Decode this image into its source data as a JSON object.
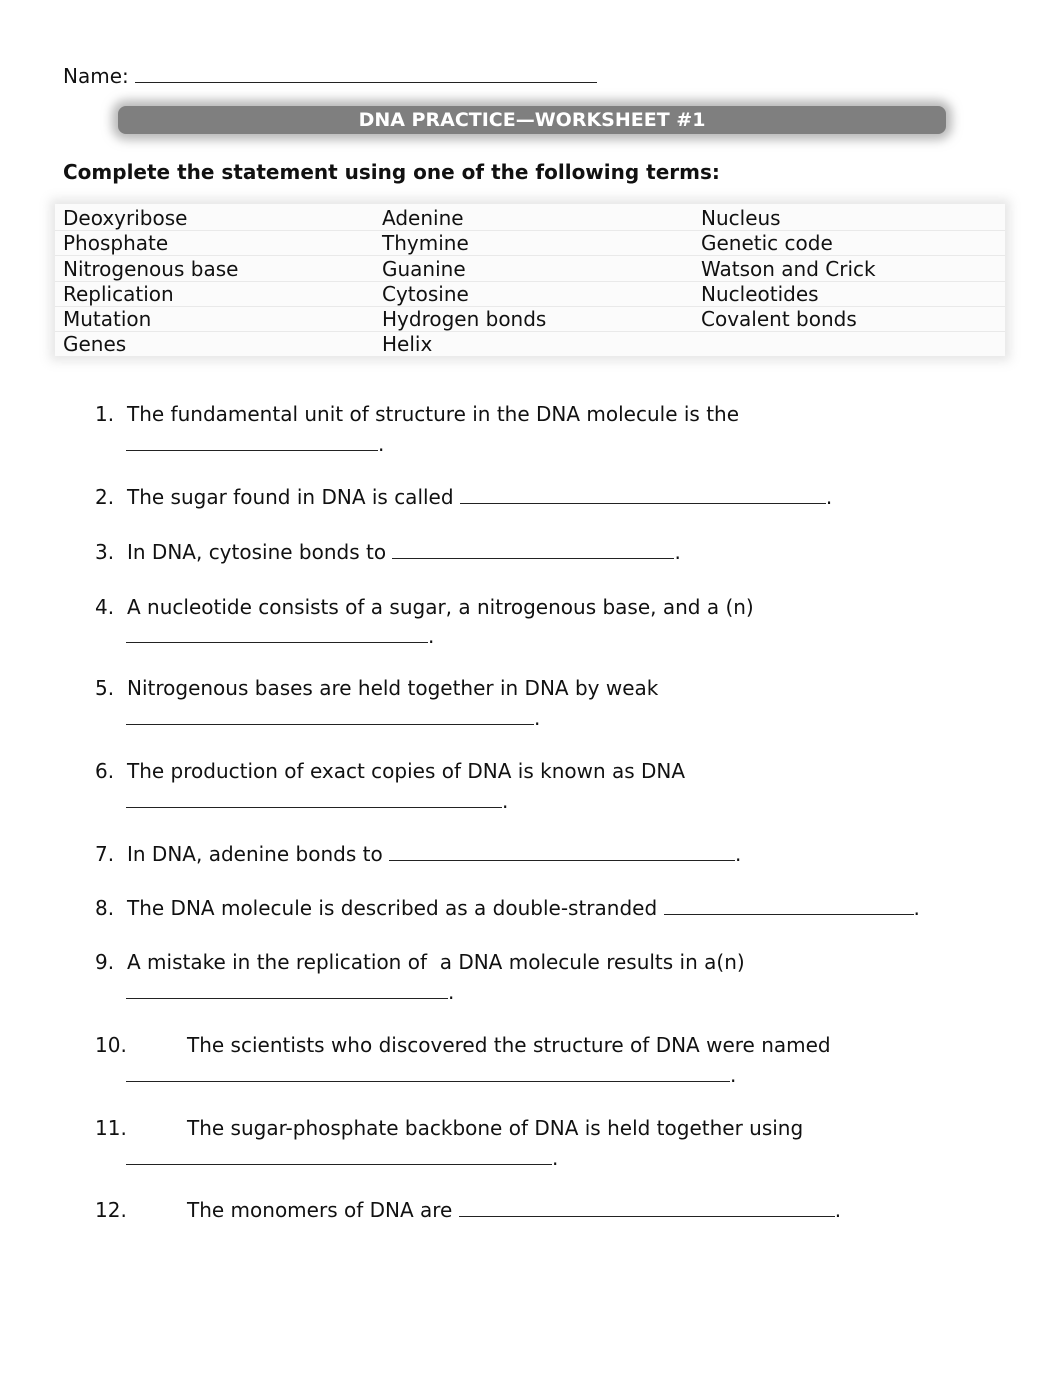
{
  "header": {
    "name_label": "Name:",
    "title": "DNA PRACTICE—WORKSHEET #1",
    "instructions": "Complete the statement using one of the following terms:"
  },
  "terms": {
    "column1": [
      "Deoxyribose",
      "Phosphate",
      "Nitrogenous base",
      "Replication",
      "Mutation",
      "Genes"
    ],
    "column2": [
      "Adenine",
      "Thymine",
      "Guanine",
      "Cytosine",
      "Hydrogen bonds",
      "Helix"
    ],
    "column3": [
      "Nucleus",
      "Genetic code",
      "Watson and Crick",
      "Nucleotides",
      "Covalent bonds",
      ""
    ]
  },
  "questions": [
    {
      "number": "1.",
      "text": "The fundamental unit of structure in the DNA molecule is the",
      "end": "."
    },
    {
      "number": "2.",
      "text": "The sugar found in DNA is called",
      "end": "."
    },
    {
      "number": "3.",
      "text": "In DNA, cytosine bonds to",
      "end": "."
    },
    {
      "number": "4.",
      "text": "A nucleotide consists of a sugar, a nitrogenous base, and a (n)",
      "end": "."
    },
    {
      "number": "5.",
      "text": "Nitrogenous bases are held together in DNA by weak",
      "end": "."
    },
    {
      "number": "6.",
      "text": "The production of exact copies of DNA is known as DNA",
      "end": "."
    },
    {
      "number": "7.",
      "text": "In DNA, adenine bonds to",
      "end": "."
    },
    {
      "number": "8.",
      "text": "The DNA molecule is described as a double-stranded",
      "end": "."
    },
    {
      "number": "9.",
      "text": "A mistake in the replication of  a DNA molecule results in a(n)",
      "end": "."
    },
    {
      "number": "10.",
      "text": "The scientists who discovered the structure of DNA were named",
      "end": "."
    },
    {
      "number": "11.",
      "text": "The sugar-phosphate backbone of DNA is held together using",
      "end": "."
    },
    {
      "number": "12.",
      "text": "The monomers of DNA are",
      "end": "."
    }
  ]
}
